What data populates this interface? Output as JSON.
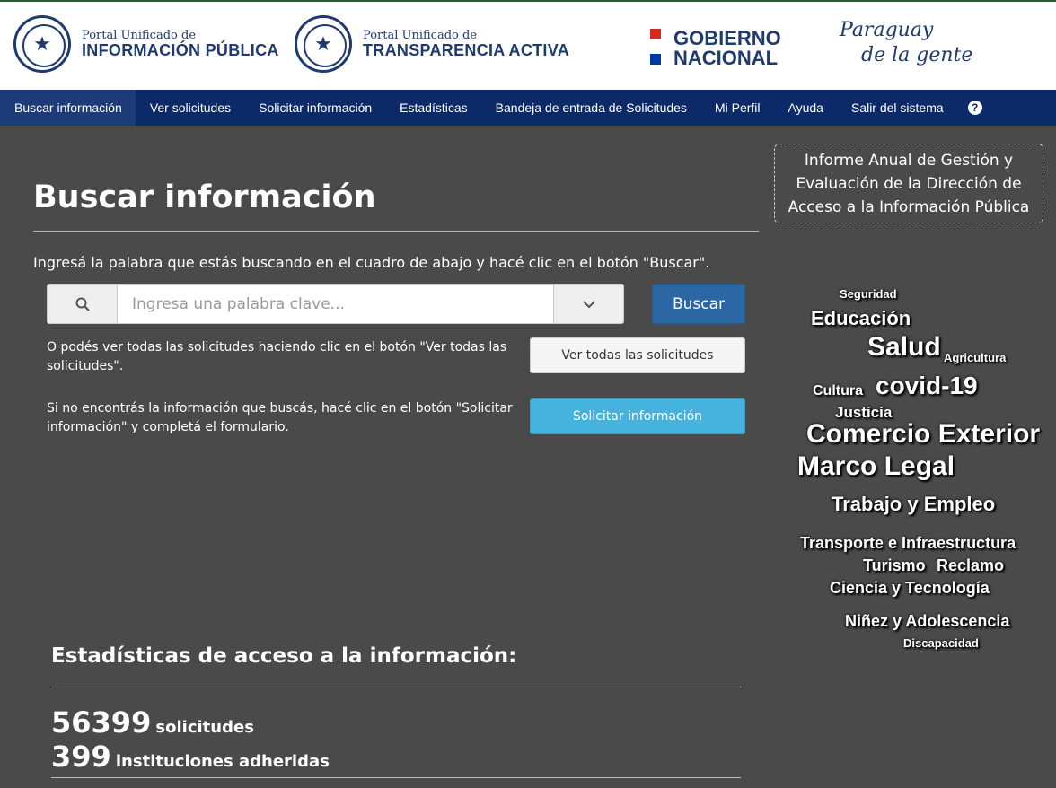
{
  "header": {
    "portal1": {
      "small": "Portal Unificado de",
      "big": "INFORMACIÓN PÚBLICA"
    },
    "portal2": {
      "small": "Portal Unificado de",
      "big": "TRANSPARENCIA ACTIVA"
    },
    "gobierno": {
      "line1": "GOBIERNO",
      "line2": "NACIONAL"
    },
    "slogan": {
      "line1": "Paraguay",
      "line2": "de la gente"
    }
  },
  "nav": {
    "items": [
      "Buscar información",
      "Ver solicitudes",
      "Solicitar información",
      "Estadísticas",
      "Bandeja de entrada de Solicitudes",
      "Mi Perfil",
      "Ayuda",
      "Salir del sistema"
    ],
    "help_icon": "?"
  },
  "main": {
    "title": "Buscar información",
    "intro": "Ingresá la palabra que estás buscando en el cuadro de abajo y hacé clic en el botón \"Buscar\".",
    "search": {
      "placeholder": "Ingresa una palabra clave...",
      "button": "Buscar"
    },
    "view_all": {
      "text": "O podés ver todas las solicitudes haciendo clic en el botón \"Ver todas las solicitudes\".",
      "button": "Ver todas las solicitudes"
    },
    "request": {
      "text": "Si no encontrás la información que buscás, hacé clic en el botón \"Solicitar información\" y completá el formulario.",
      "button": "Solicitar información"
    }
  },
  "stats": {
    "title": "Estadísticas de acceso a la información:",
    "requests": {
      "value": "56399",
      "label": "solicitudes"
    },
    "institutions": {
      "value": "399",
      "label": "instituciones adheridas"
    }
  },
  "report": {
    "text": "Informe Anual de Gestión y Evaluación de la Dirección de Acceso a la Información Pública"
  },
  "word_cloud": [
    {
      "text": "Seguridad",
      "weight": 1
    },
    {
      "text": "Educación",
      "weight": 2
    },
    {
      "text": "Salud",
      "weight": 3
    },
    {
      "text": "Agricultura",
      "weight": 1
    },
    {
      "text": "Cultura",
      "weight": 1
    },
    {
      "text": "covid-19",
      "weight": 3
    },
    {
      "text": "Justicia",
      "weight": 1
    },
    {
      "text": "Comercio Exterior",
      "weight": 3
    },
    {
      "text": "Marco Legal",
      "weight": 3
    },
    {
      "text": "Trabajo y Empleo",
      "weight": 2
    },
    {
      "text": "Transporte e Infraestructura",
      "weight": 1
    },
    {
      "text": "Turismo",
      "weight": 1
    },
    {
      "text": "Reclamo",
      "weight": 1
    },
    {
      "text": "Ciencia y Tecnología",
      "weight": 1
    },
    {
      "text": "Niñez y Adolescencia",
      "weight": 1
    },
    {
      "text": "Discapacidad",
      "weight": 1
    }
  ],
  "colors": {
    "nav_bg": "#0b2a67",
    "page_bg": "#4a4a4a",
    "primary": "#2b67a3",
    "info": "#45b3de",
    "flag_red": "#d52b1e",
    "flag_blue": "#0038a8"
  }
}
